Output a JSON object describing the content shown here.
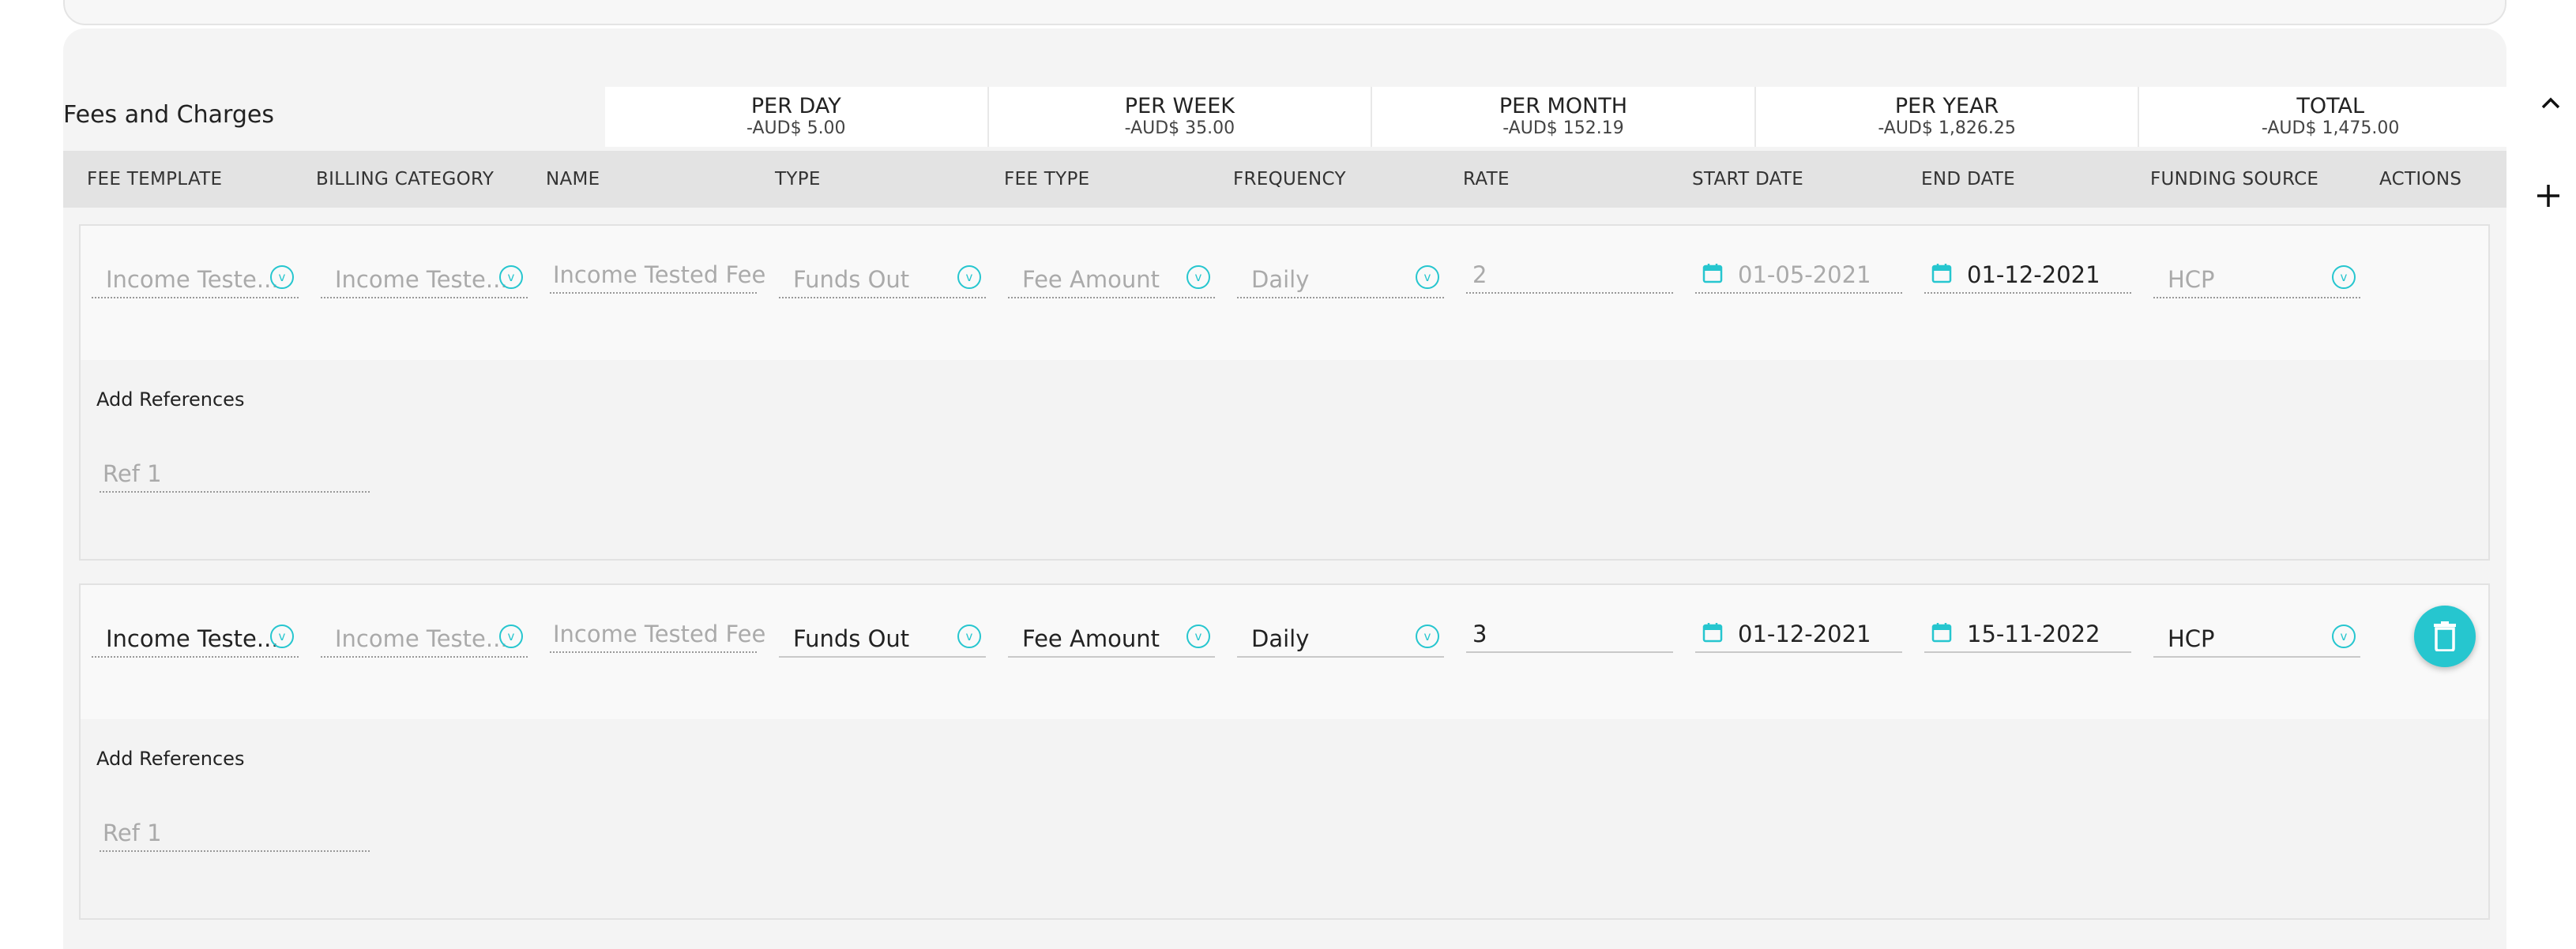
{
  "section": {
    "title": "Fees and Charges"
  },
  "summary": [
    {
      "label": "PER DAY",
      "value": "-AUD$ 5.00"
    },
    {
      "label": "PER WEEK",
      "value": "-AUD$ 35.00"
    },
    {
      "label": "PER MONTH",
      "value": "-AUD$ 152.19"
    },
    {
      "label": "PER YEAR",
      "value": "-AUD$ 1,826.25"
    },
    {
      "label": "TOTAL",
      "value": "-AUD$ 1,475.00"
    }
  ],
  "columns": [
    "FEE TEMPLATE",
    "BILLING CATEGORY",
    "NAME",
    "TYPE",
    "FEE TYPE",
    "FREQUENCY",
    "RATE",
    "START DATE",
    "END DATE",
    "FUNDING SOURCE",
    "ACTIONS"
  ],
  "rows": [
    {
      "fee_template": "Income Teste...",
      "billing_category": "Income Teste...",
      "name": "Income Tested Fee",
      "type": "Funds Out",
      "fee_type": "Fee Amount",
      "frequency": "Daily",
      "rate": "2",
      "start_date": "01-05-2021",
      "end_date": "01-12-2021",
      "funding_source": "HCP",
      "refs_label": "Add References",
      "ref_placeholder": "Ref 1"
    },
    {
      "fee_template": "Income Teste...",
      "billing_category": "Income Teste...",
      "name": "Income Tested Fee",
      "type": "Funds Out",
      "fee_type": "Fee Amount",
      "frequency": "Daily",
      "rate": "3",
      "start_date": "01-12-2021",
      "end_date": "15-11-2022",
      "funding_source": "HCP",
      "refs_label": "Add References",
      "ref_placeholder": "Ref 1"
    }
  ],
  "icons": {
    "dropdown": "v",
    "calendar": "calendar-icon",
    "collapse": "chevron-up-icon",
    "add": "plus-icon",
    "delete": "trash-icon"
  },
  "colors": {
    "accent": "#26c6cf"
  }
}
